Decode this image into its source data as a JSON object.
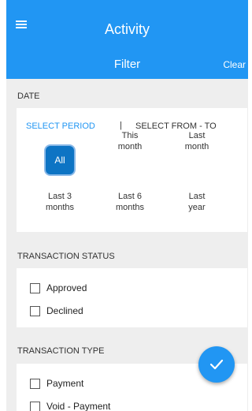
{
  "header": {
    "title": "Activity",
    "filter_label": "Filter",
    "clear_label": "Clear"
  },
  "date": {
    "section_label": "DATE",
    "select_period": "SELECT PERIOD",
    "separator": "|",
    "select_range": "SELECT FROM - TO",
    "options": [
      {
        "line1": "All",
        "line2": ""
      },
      {
        "line1": "This",
        "line2": "month"
      },
      {
        "line1": "Last",
        "line2": "month"
      },
      {
        "line1": "Last 3",
        "line2": "months"
      },
      {
        "line1": "Last 6",
        "line2": "months"
      },
      {
        "line1": "Last",
        "line2": "year"
      }
    ],
    "selected": "All"
  },
  "transaction_status": {
    "section_label": "TRANSACTION STATUS",
    "items": [
      {
        "label": "Approved",
        "checked": false
      },
      {
        "label": "Declined",
        "checked": false
      }
    ]
  },
  "transaction_type": {
    "section_label": "TRANSACTION TYPE",
    "items": [
      {
        "label": "Payment",
        "checked": false
      },
      {
        "label": "Void - Payment",
        "checked": false
      }
    ]
  },
  "fab": {
    "icon": "checkmark-icon"
  },
  "colors": {
    "primary": "#2196f3",
    "selected_pill": "#0d74c4",
    "background": "#eeeeee"
  }
}
